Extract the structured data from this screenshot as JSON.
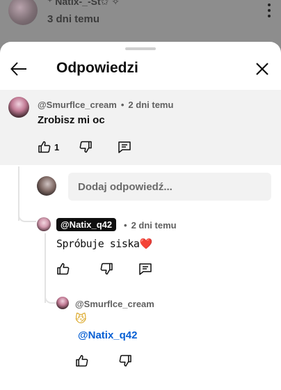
{
  "background": {
    "author": "⁺ Natix-_-St✩ ✧",
    "time": "3 dni temu"
  },
  "header": {
    "title": "Odpowiedzi"
  },
  "parent_comment": {
    "author": "@Smurflce_cream",
    "time": "2 dni temu",
    "text": "Zrobisz mi oc",
    "likes": "1"
  },
  "reply_box": {
    "placeholder": "Dodaj odpowiedź..."
  },
  "reply_1": {
    "author": "@Natix_q42",
    "time": "2 dni temu",
    "text": "Spróbuje siska",
    "emoji": "❤️"
  },
  "reply_2": {
    "author": "@Smurflce_cream",
    "emoji": "😼",
    "mention": "@Natix_q42"
  },
  "separator": "•",
  "colors": {
    "mention_blue": "#065fd4",
    "chip_black": "#0f0f0f",
    "heart_red": "#e0202c"
  }
}
